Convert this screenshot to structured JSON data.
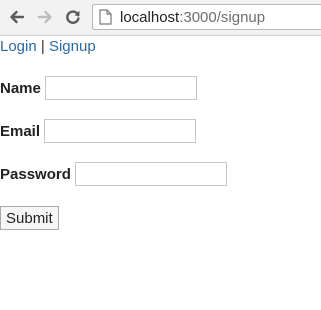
{
  "browser": {
    "url_host": "localhost",
    "url_path": ":3000/signup",
    "back_icon": "arrow-left-icon",
    "forward_icon": "arrow-right-icon",
    "reload_icon": "reload-icon",
    "page_icon": "document-icon"
  },
  "nav": {
    "login_label": "Login",
    "separator": "|",
    "signup_label": "Signup"
  },
  "form": {
    "name_label": "Name",
    "name_value": "",
    "email_label": "Email",
    "email_value": "",
    "password_label": "Password",
    "password_value": "",
    "submit_label": "Submit"
  },
  "colors": {
    "link": "#2b6aa5",
    "toolbar_bg": "#f2f2f2"
  }
}
